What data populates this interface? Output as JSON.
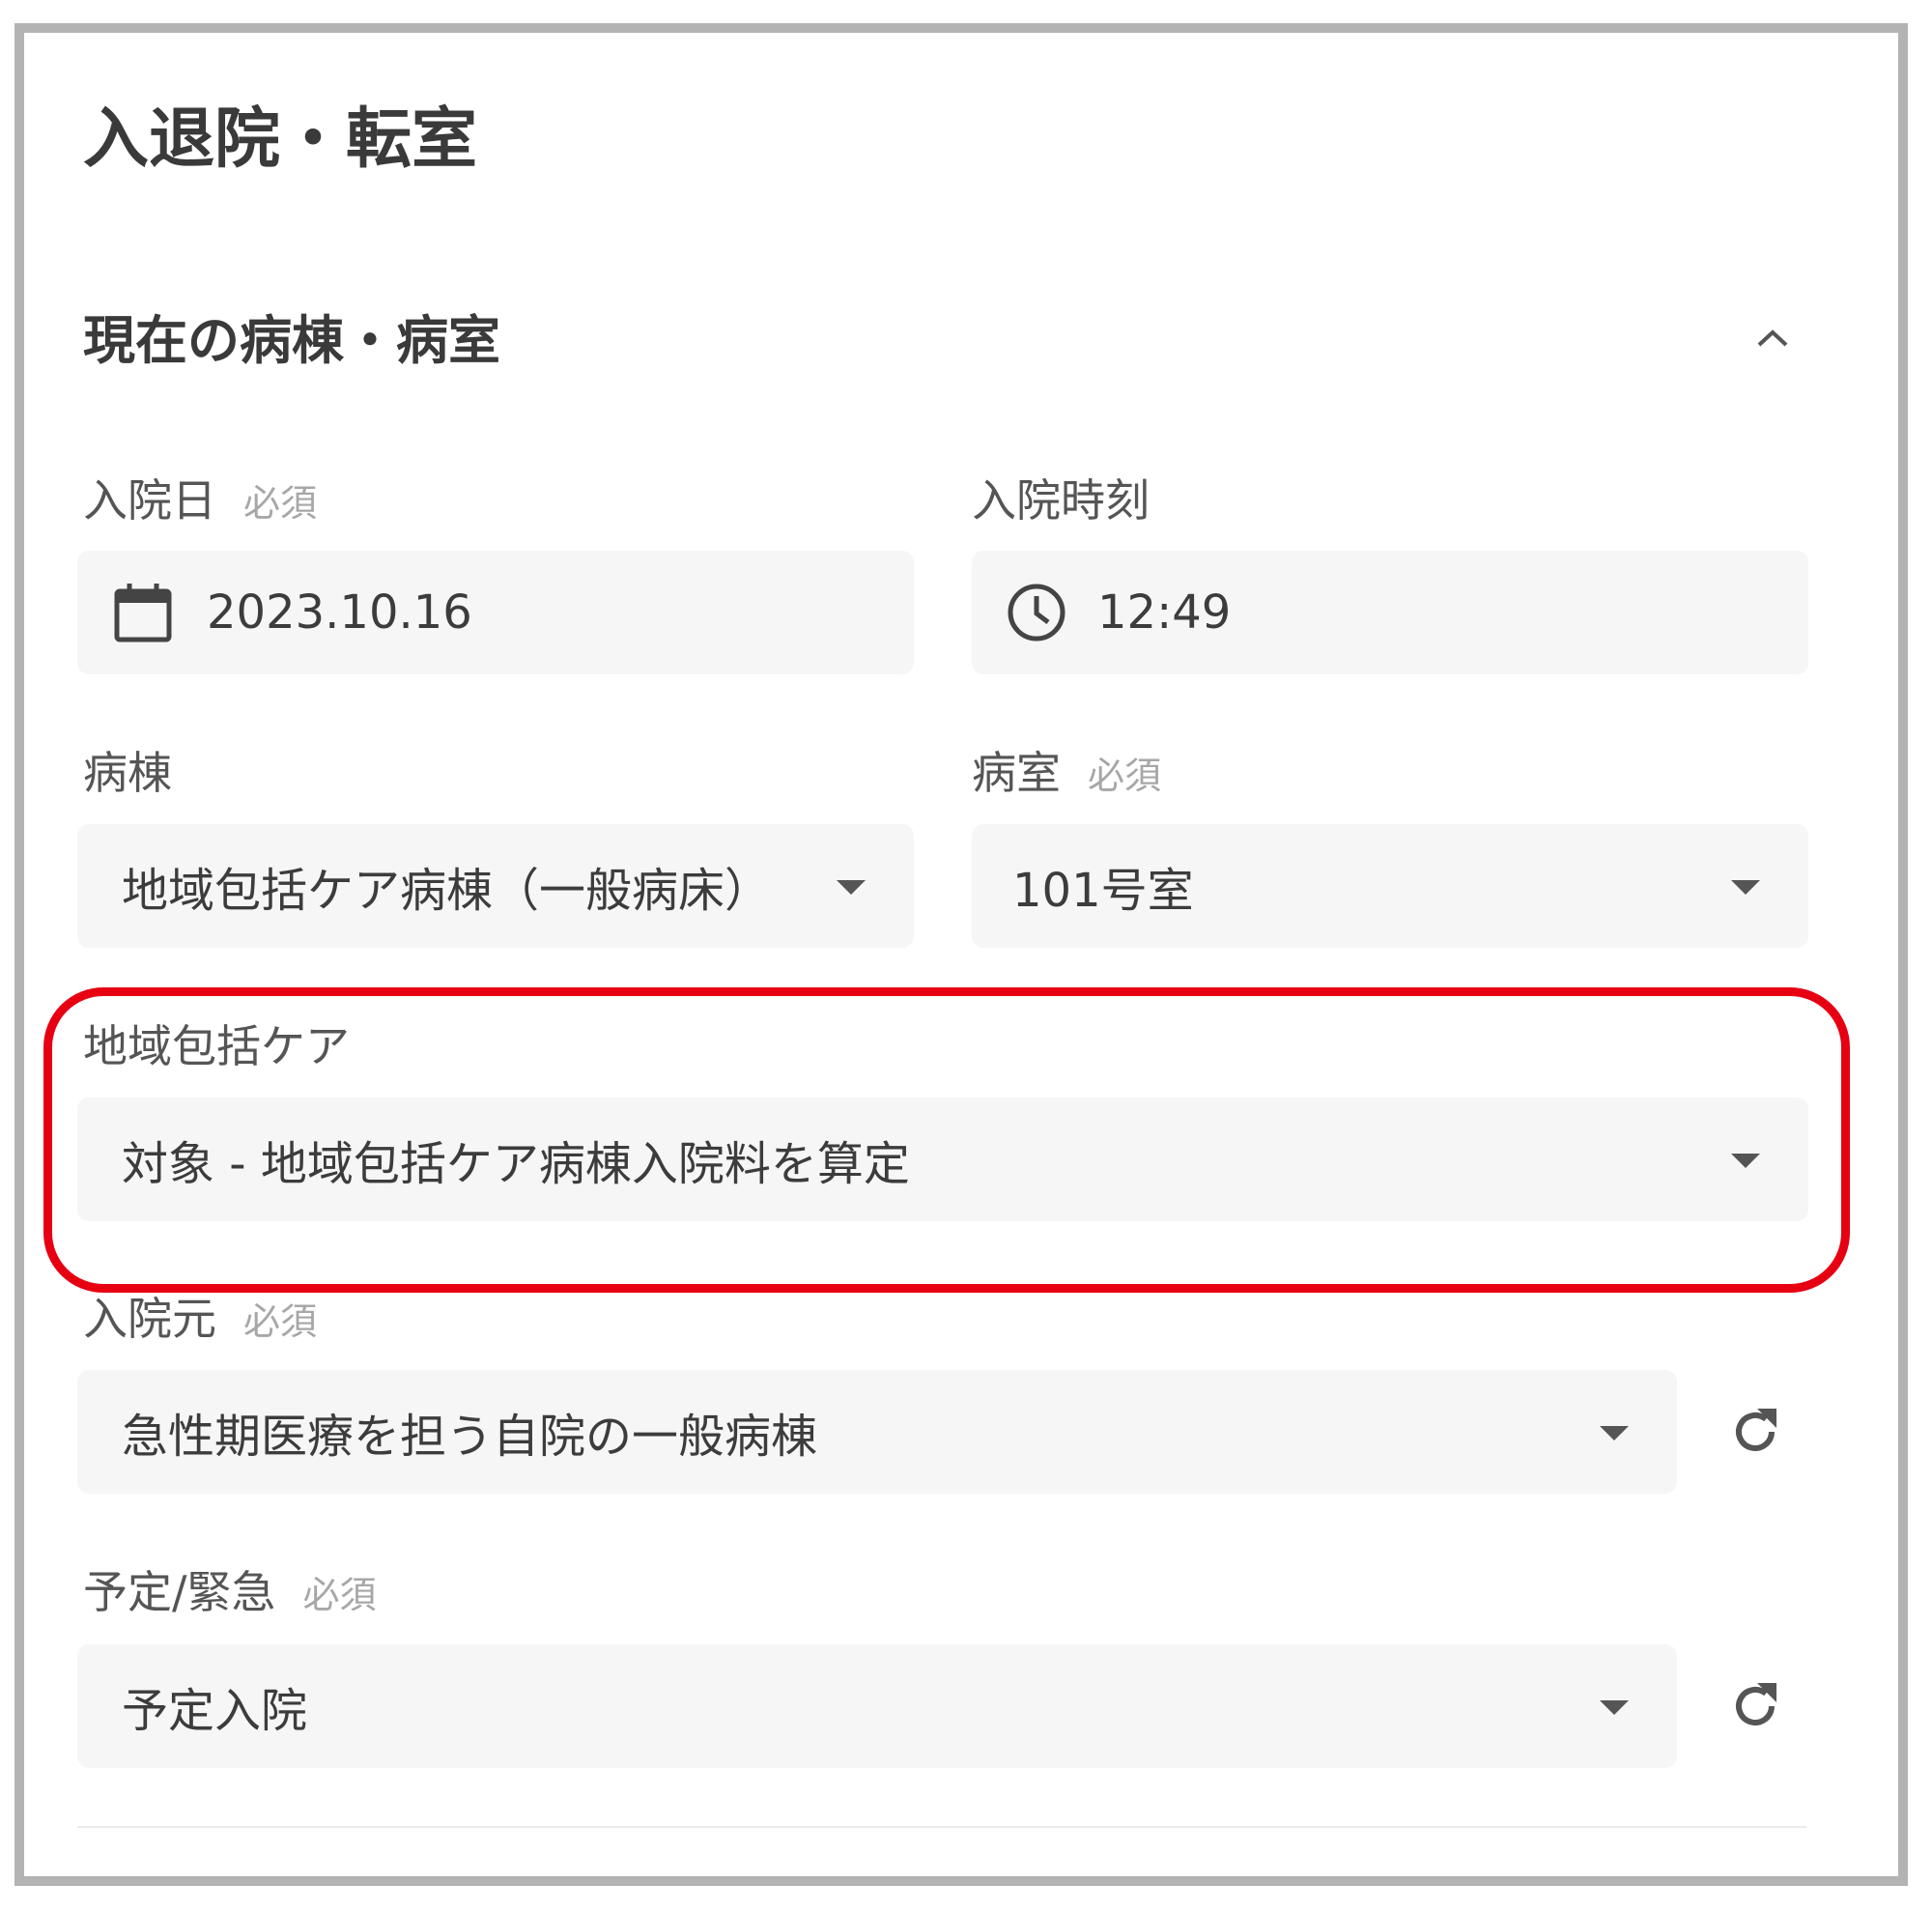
{
  "page": {
    "title": "入退院・転室"
  },
  "section": {
    "title": "現在の病棟・病室",
    "collapse_icon": "chevron-up-icon"
  },
  "fields": {
    "admission_date": {
      "label": "入院日",
      "required": "必須",
      "value": "2023.10.16",
      "icon": "calendar-icon"
    },
    "admission_time": {
      "label": "入院時刻",
      "value": "12:49",
      "icon": "clock-icon"
    },
    "ward": {
      "label": "病棟",
      "value": "地域包括ケア病棟（一般病床）"
    },
    "room": {
      "label": "病室",
      "required": "必須",
      "value": "101号室"
    },
    "community_care": {
      "label": "地域包括ケア",
      "value": "対象 - 地域包括ケア病棟入院料を算定"
    },
    "admission_source": {
      "label": "入院元",
      "required": "必須",
      "value": "急性期医療を担う自院の一般病棟"
    },
    "planned_emergency": {
      "label": "予定/緊急",
      "required": "必須",
      "value": "予定入院"
    }
  },
  "colors": {
    "highlight": "#e60012",
    "field_bg": "#f6f6f6",
    "frame": "#b3b3b3"
  }
}
